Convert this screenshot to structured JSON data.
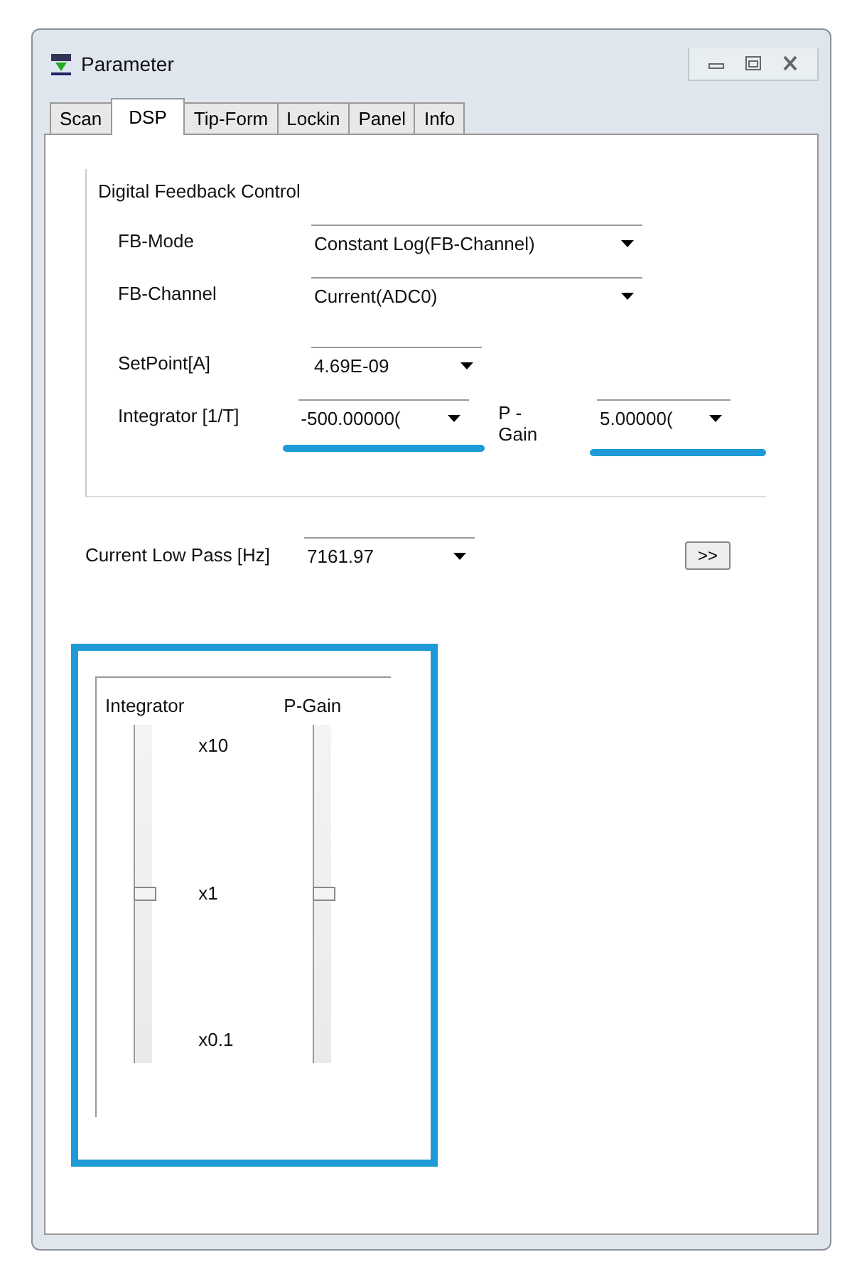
{
  "window": {
    "title": "Parameter"
  },
  "tabs": [
    {
      "label": "Scan",
      "selected": false
    },
    {
      "label": "DSP",
      "selected": true
    },
    {
      "label": "Tip-Form",
      "selected": false
    },
    {
      "label": "Lockin",
      "selected": false
    },
    {
      "label": "Panel",
      "selected": false
    },
    {
      "label": "Info",
      "selected": false
    }
  ],
  "feedback_group": {
    "title": "Digital Feedback Control",
    "fb_mode": {
      "label": "FB-Mode",
      "value": "Constant Log(FB-Channel)"
    },
    "fb_channel": {
      "label": "FB-Channel",
      "value": "Current(ADC0)"
    },
    "setpoint": {
      "label": "SetPoint[A]",
      "value": "4.69E-09"
    },
    "integrator": {
      "label": "Integrator [1/T]",
      "value": "-500.00000(",
      "highlighted": true
    },
    "p_gain": {
      "label": "P - Gain",
      "value": "5.00000(",
      "highlighted": true
    }
  },
  "low_pass": {
    "label": "Current Low Pass [Hz]",
    "value": "7161.97"
  },
  "more_button": {
    "label": ">>"
  },
  "slider_group": {
    "highlighted": true,
    "sliders": [
      {
        "label": "Integrator",
        "level": 0.5
      },
      {
        "label": "P-Gain",
        "level": 0.5
      }
    ],
    "scale_labels": [
      "x10",
      "x1",
      "x0.1"
    ]
  }
}
